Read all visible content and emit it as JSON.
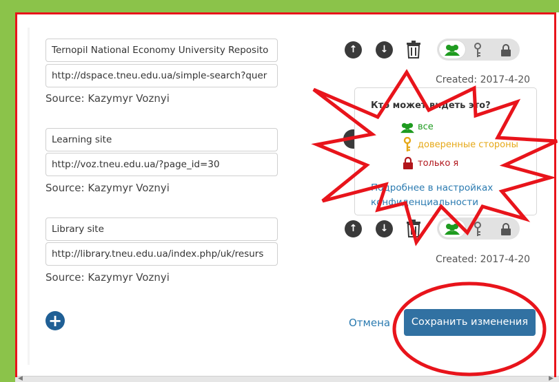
{
  "links": [
    {
      "title": "Ternopil National Economy University Reposito",
      "url": "http://dspace.tneu.edu.ua/simple-search?quer",
      "source": "Source: Kazymyr Voznyi",
      "created": "Created: 2017-4-20"
    },
    {
      "title": "Learning site",
      "url": "http://voz.tneu.edu.ua/?page_id=30",
      "source": "Source: Kazymyr Voznyi"
    },
    {
      "title": "Library site",
      "url": "http://library.tneu.edu.ua/index.php/uk/resurs",
      "source": "Source: Kazymyr Voznyi",
      "created": "Created: 2017-4-20"
    }
  ],
  "popover": {
    "title": "Кто может видеть это?",
    "options": [
      {
        "label": "все",
        "icon": "group-icon",
        "color": "#1f9b20"
      },
      {
        "label": "доверенные стороны",
        "icon": "key-icon",
        "color": "#e6a817"
      },
      {
        "label": "только я",
        "icon": "lock-icon",
        "color": "#b1151b"
      }
    ],
    "link_line1": "Подробнее в настройках",
    "link_line2": "конфиденциальности"
  },
  "actions": {
    "cancel": "Отмена",
    "save": "Сохранить изменения"
  },
  "colors": {
    "accent": "#3171a2",
    "annotation": "#e8141b",
    "background": "#8bc34a"
  }
}
